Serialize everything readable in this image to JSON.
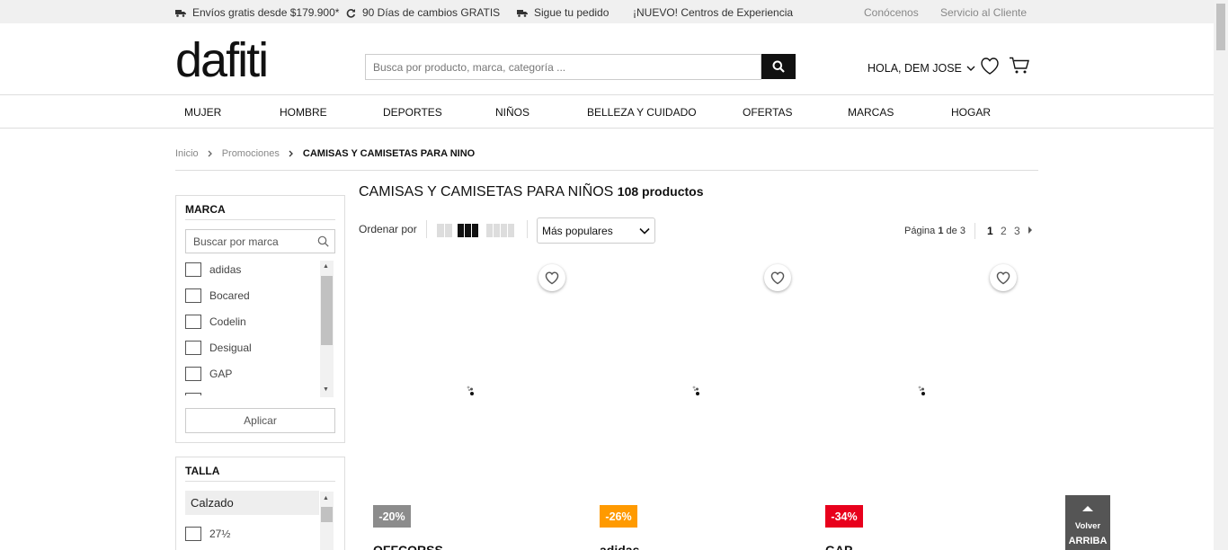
{
  "topbar": {
    "shipping": "Envíos gratis desde $179.900*",
    "returns": "90 Días de cambios GRATIS",
    "track": "Sigue tu pedido",
    "centers": "¡NUEVO! Centros de Experiencia",
    "about": "Conócenos",
    "service": "Servicio al Cliente"
  },
  "header": {
    "logo": "dafiti",
    "search_placeholder": "Busca por producto, marca, categoría ...",
    "greeting": "HOLA, DEM JOSE"
  },
  "nav": [
    "MUJER",
    "HOMBRE",
    "DEPORTES",
    "NIÑOS",
    "BELLEZA Y CUIDADO",
    "OFERTAS",
    "MARCAS",
    "HOGAR"
  ],
  "breadcrumb": {
    "home": "Inicio",
    "section": "Promociones",
    "current": "CAMISAS Y CAMISETAS PARA NINO"
  },
  "filters": {
    "brand": {
      "title": "MARCA",
      "search_placeholder": "Buscar por marca",
      "items": [
        "adidas",
        "Bocared",
        "Codelin",
        "Desigual",
        "GAP"
      ],
      "apply": "Aplicar"
    },
    "size": {
      "title": "TALLA",
      "group": "Calzado",
      "items": [
        "27½"
      ]
    }
  },
  "listing": {
    "title": "CAMISAS Y CAMISETAS PARA NIÑOS",
    "count": "108 productos",
    "sort_label": "Ordenar por",
    "sort_value": "Más populares",
    "page_prefix": "Página",
    "page_current": "1",
    "page_of": "de",
    "page_total": "3",
    "pages": [
      "1",
      "2",
      "3"
    ]
  },
  "products": [
    {
      "discount": "-20%",
      "discount_color": "#8c8c8c",
      "name": "OFFCORSS"
    },
    {
      "discount": "-26%",
      "discount_color": "#ff9a00",
      "name": "adidas"
    },
    {
      "discount": "-34%",
      "discount_color": "#e8001c",
      "name": "GAP"
    }
  ],
  "back_to_top": {
    "line1": "Volver",
    "line2": "ARRIBA"
  }
}
